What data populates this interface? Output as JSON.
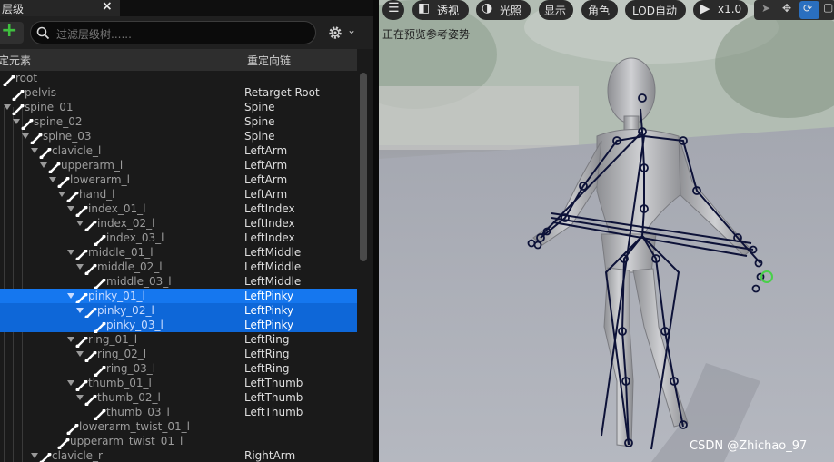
{
  "panel": {
    "tab_title": "层级",
    "tab_close": "×",
    "add_label": "+",
    "search_placeholder": "过滤层级树......",
    "col_bone": "定元素",
    "col_chain": "重定向链"
  },
  "rows": [
    {
      "name": "root",
      "chain": "",
      "depth": 0,
      "arrow": false,
      "selected": false
    },
    {
      "name": "pelvis",
      "chain": "Retarget Root",
      "depth": 1,
      "arrow": false,
      "selected": false
    },
    {
      "name": "spine_01",
      "chain": "Spine",
      "depth": 1,
      "arrow": true,
      "selected": false
    },
    {
      "name": "spine_02",
      "chain": "Spine",
      "depth": 2,
      "arrow": true,
      "selected": false
    },
    {
      "name": "spine_03",
      "chain": "Spine",
      "depth": 3,
      "arrow": true,
      "selected": false
    },
    {
      "name": "clavicle_l",
      "chain": "LeftArm",
      "depth": 4,
      "arrow": true,
      "selected": false
    },
    {
      "name": "upperarm_l",
      "chain": "LeftArm",
      "depth": 5,
      "arrow": true,
      "selected": false
    },
    {
      "name": "lowerarm_l",
      "chain": "LeftArm",
      "depth": 6,
      "arrow": true,
      "selected": false
    },
    {
      "name": "hand_l",
      "chain": "LeftArm",
      "depth": 7,
      "arrow": true,
      "selected": false
    },
    {
      "name": "index_01_l",
      "chain": "LeftIndex",
      "depth": 8,
      "arrow": true,
      "selected": false
    },
    {
      "name": "index_02_l",
      "chain": "LeftIndex",
      "depth": 9,
      "arrow": true,
      "selected": false
    },
    {
      "name": "index_03_l",
      "chain": "LeftIndex",
      "depth": 10,
      "arrow": false,
      "selected": false
    },
    {
      "name": "middle_01_l",
      "chain": "LeftMiddle",
      "depth": 8,
      "arrow": true,
      "selected": false
    },
    {
      "name": "middle_02_l",
      "chain": "LeftMiddle",
      "depth": 9,
      "arrow": true,
      "selected": false
    },
    {
      "name": "middle_03_l",
      "chain": "LeftMiddle",
      "depth": 10,
      "arrow": false,
      "selected": false
    },
    {
      "name": "pinky_01_l",
      "chain": "LeftPinky",
      "depth": 8,
      "arrow": true,
      "selected": true
    },
    {
      "name": "pinky_02_l",
      "chain": "LeftPinky",
      "depth": 9,
      "arrow": true,
      "selected": true
    },
    {
      "name": "pinky_03_l",
      "chain": "LeftPinky",
      "depth": 10,
      "arrow": false,
      "selected": true
    },
    {
      "name": "ring_01_l",
      "chain": "LeftRing",
      "depth": 8,
      "arrow": true,
      "selected": false
    },
    {
      "name": "ring_02_l",
      "chain": "LeftRing",
      "depth": 9,
      "arrow": true,
      "selected": false
    },
    {
      "name": "ring_03_l",
      "chain": "LeftRing",
      "depth": 10,
      "arrow": false,
      "selected": false
    },
    {
      "name": "thumb_01_l",
      "chain": "LeftThumb",
      "depth": 8,
      "arrow": true,
      "selected": false
    },
    {
      "name": "thumb_02_l",
      "chain": "LeftThumb",
      "depth": 9,
      "arrow": true,
      "selected": false
    },
    {
      "name": "thumb_03_l",
      "chain": "LeftThumb",
      "depth": 10,
      "arrow": false,
      "selected": false
    },
    {
      "name": "lowerarm_twist_01_l",
      "chain": "",
      "depth": 7,
      "arrow": false,
      "selected": false
    },
    {
      "name": "upperarm_twist_01_l",
      "chain": "",
      "depth": 6,
      "arrow": false,
      "selected": false
    },
    {
      "name": "clavicle_r",
      "chain": "RightArm",
      "depth": 4,
      "arrow": true,
      "selected": false
    }
  ],
  "viewport": {
    "menu_icon": "hamburger-icon",
    "perspective_label": "透视",
    "lighting_label": "光照",
    "show_label": "显示",
    "character_label": "角色",
    "lod_label": "LOD自动",
    "speed_label": "x1.0",
    "status_text": "正在预览参考姿势",
    "watermark": "CSDN @Zhichao_97"
  },
  "colors": {
    "selection": "#0e67d8",
    "accent_green": "#3fbf3f",
    "panel_bg": "#1a1a1a"
  }
}
